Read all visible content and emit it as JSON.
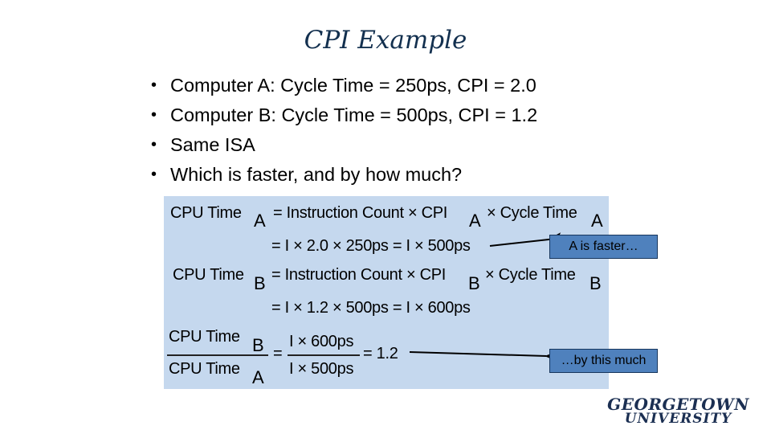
{
  "slide": {
    "title": "CPI Example",
    "bullets": [
      {
        "marker": "•",
        "text": "Computer A: Cycle Time = 250ps, CPI = 2.0"
      },
      {
        "marker": "•",
        "text": "Computer B: Cycle Time = 500ps, CPI = 1.2"
      },
      {
        "marker": "•",
        "text": "Same ISA"
      },
      {
        "marker": "•",
        "text": "Which is faster, and by how much?"
      }
    ]
  },
  "formulas": {
    "row1": {
      "lhs": "CPU Time",
      "lhs_sub": "A",
      "rhs_a": "= Instruction Count × CPI",
      "rhs_a_sub": "A",
      "rhs_b": "× Cycle Time",
      "rhs_b_sub": "A"
    },
    "row2": {
      "text": "= I × 2.0 × 250ps = I × 500ps"
    },
    "row3": {
      "lhs": "CPU Time",
      "lhs_sub": "B",
      "rhs_a": "= Instruction Count × CPI",
      "rhs_a_sub": "B",
      "rhs_b": "× Cycle Time",
      "rhs_b_sub": "B"
    },
    "row4": {
      "text": "= I × 1.2 × 500ps = I × 600ps"
    },
    "ratio": {
      "num": "CPU Time",
      "num_sub": "B",
      "den": "CPU Time",
      "den_sub": "A",
      "eq1": "=",
      "num2": "I × 600ps",
      "den2": "I × 500ps",
      "result": "= 1.2"
    }
  },
  "callouts": {
    "faster": "A is faster…",
    "how_much": "…by this much"
  },
  "logo": {
    "line1": "GEORGETOWN",
    "line2": "UNIVERSITY"
  },
  "colors": {
    "title": "#13304f",
    "formula_background": "#c5d8ee",
    "callout_fill": "#4f81bd",
    "callout_border": "#17365d",
    "logo": "#1b2f52"
  }
}
